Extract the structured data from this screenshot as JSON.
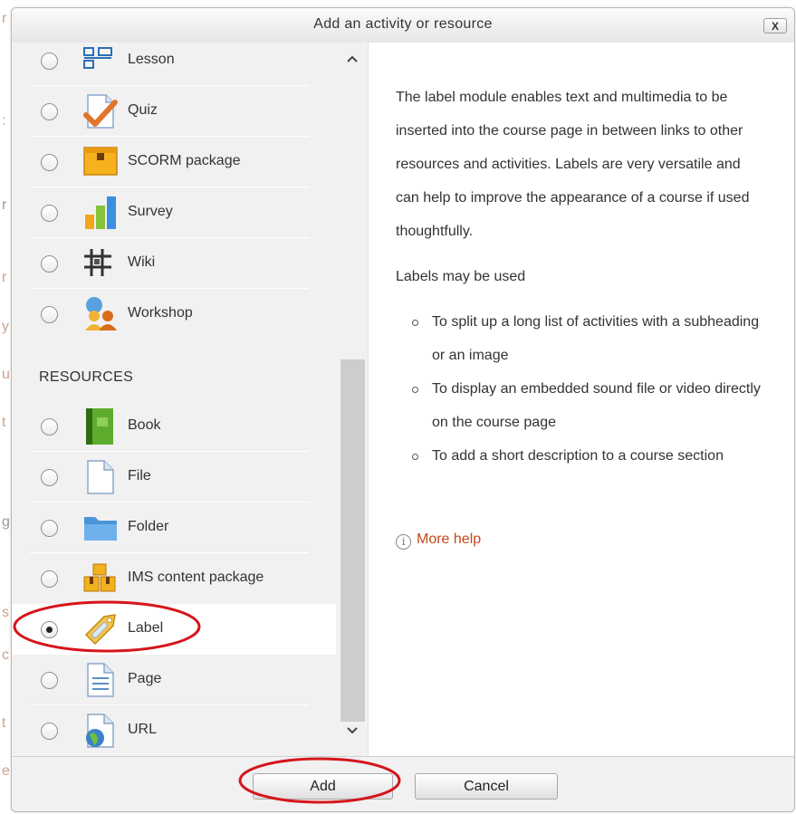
{
  "dialog": {
    "title": "Add an activity or resource",
    "close_label": "X"
  },
  "list": {
    "items": [
      {
        "label": "Lesson",
        "icon": "lesson-icon"
      },
      {
        "label": "Quiz",
        "icon": "quiz-icon"
      },
      {
        "label": "SCORM package",
        "icon": "scorm-package-icon"
      },
      {
        "label": "Survey",
        "icon": "survey-icon"
      },
      {
        "label": "Wiki",
        "icon": "wiki-icon"
      },
      {
        "label": "Workshop",
        "icon": "workshop-icon"
      }
    ],
    "resources_heading": "RESOURCES",
    "resources": [
      {
        "label": "Book",
        "icon": "book-icon"
      },
      {
        "label": "File",
        "icon": "file-icon"
      },
      {
        "label": "Folder",
        "icon": "folder-icon"
      },
      {
        "label": "IMS content package",
        "icon": "ims-content-package-icon"
      },
      {
        "label": "Label",
        "icon": "label-tag-icon",
        "selected": true
      },
      {
        "label": "Page",
        "icon": "page-icon"
      },
      {
        "label": "URL",
        "icon": "url-globe-icon"
      }
    ]
  },
  "description": {
    "intro": "The label module enables text and multimedia to be inserted into the course page in between links to other resources and activities. Labels are very versatile and can help to improve the appearance of a course if used thoughtfully.",
    "uses_heading": "Labels may be used",
    "uses": [
      "To split up a long list of activities with a subheading or an image",
      "To display an embedded sound file or video directly on the course page",
      "To add a short description to a course section"
    ],
    "more_help": "More help"
  },
  "footer": {
    "add_label": "Add",
    "cancel_label": "Cancel"
  },
  "colors": {
    "link": "#c4481a",
    "annotation": "#d6141b"
  }
}
